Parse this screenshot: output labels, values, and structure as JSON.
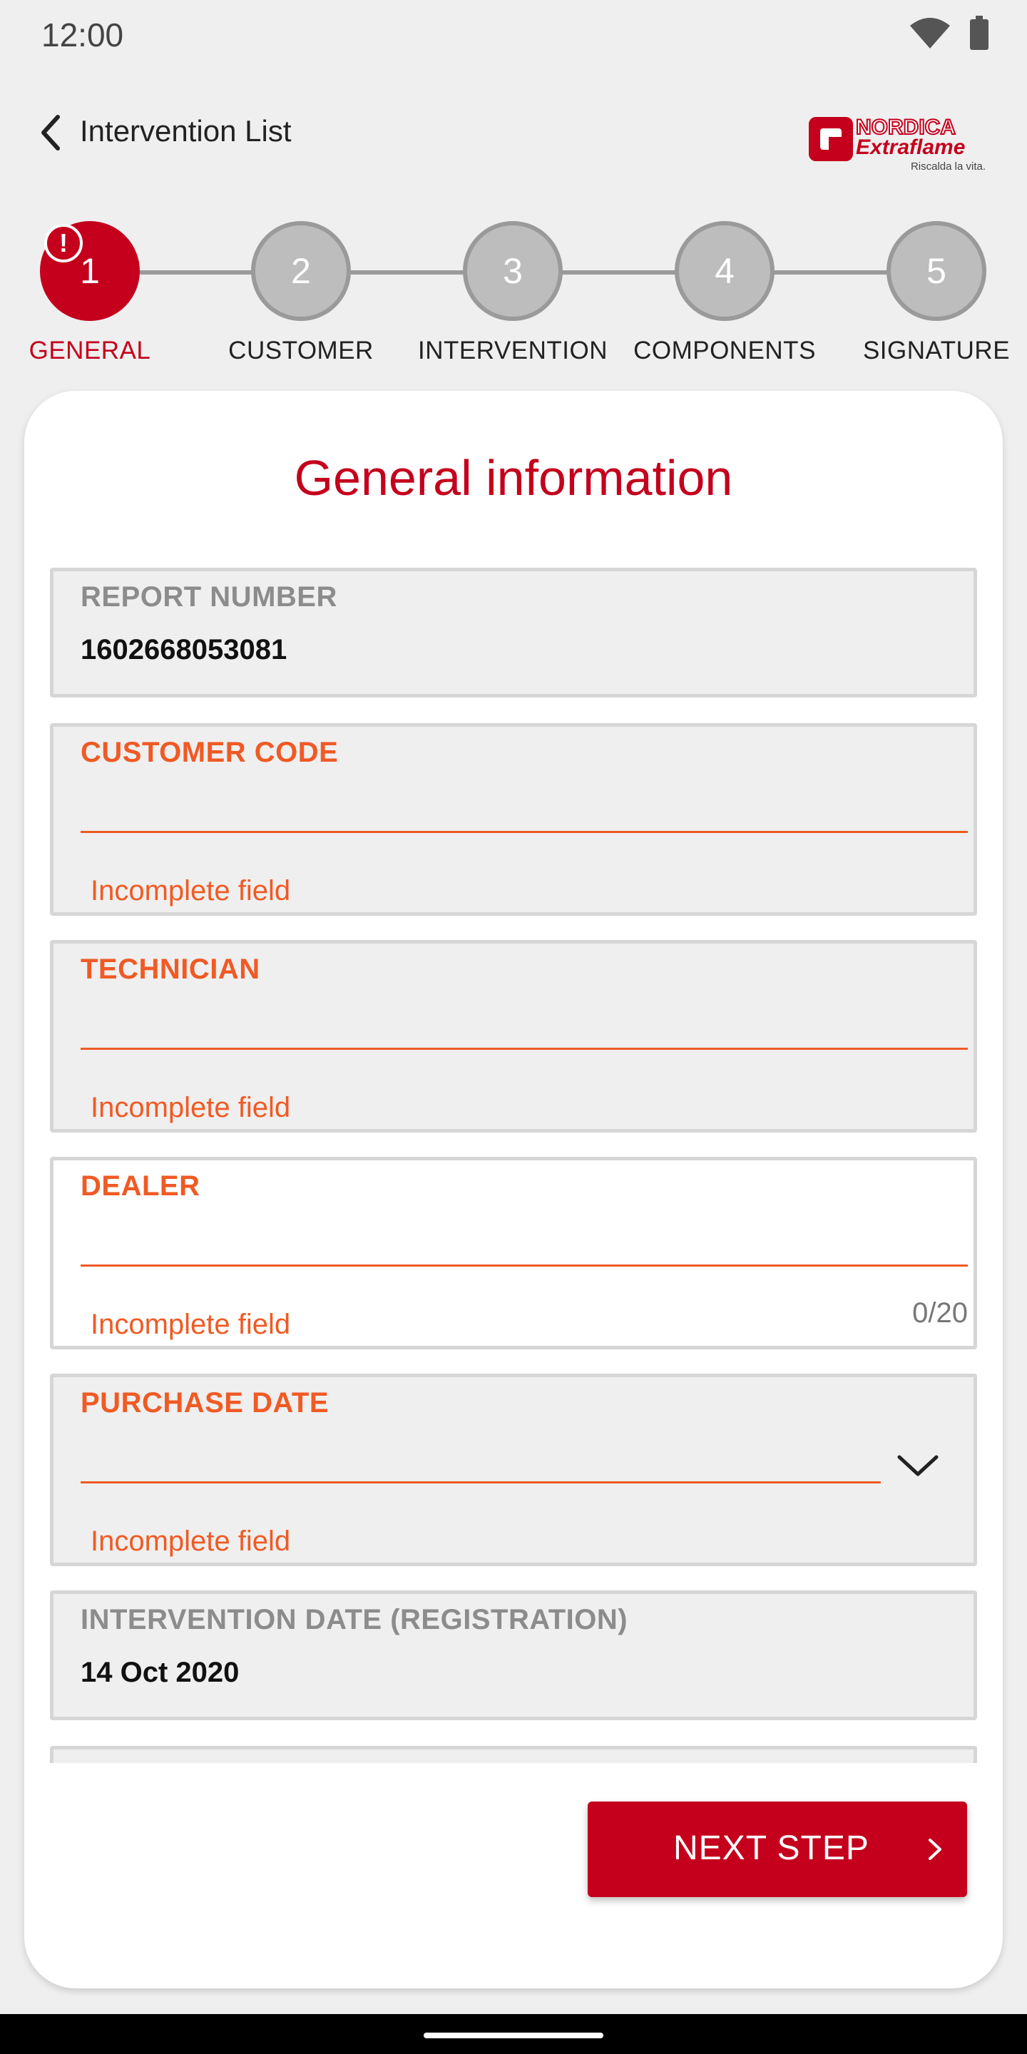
{
  "status_bar": {
    "time": "12:00",
    "icons": [
      "wifi-icon",
      "battery-icon"
    ]
  },
  "app_bar": {
    "back_label": "Intervention List"
  },
  "logo": {
    "brand_top": "NORDICA",
    "brand_bottom": "Extraflame",
    "tagline": "Riscalda la vita."
  },
  "stepper": {
    "steps": [
      {
        "number": "1",
        "label": "GENERAL",
        "active": true,
        "alert": "!"
      },
      {
        "number": "2",
        "label": "CUSTOMER"
      },
      {
        "number": "3",
        "label": "INTERVENTION"
      },
      {
        "number": "4",
        "label": "COMPONENTS"
      },
      {
        "number": "5",
        "label": "SIGNATURE"
      }
    ]
  },
  "form": {
    "title": "General information",
    "report_number": {
      "label": "REPORT NUMBER",
      "value": "1602668053081"
    },
    "customer_code": {
      "label": "CUSTOMER CODE",
      "value": "",
      "error": "Incomplete field"
    },
    "technician": {
      "label": "TECHNICIAN",
      "value": "",
      "error": "Incomplete field"
    },
    "dealer": {
      "label": "DEALER",
      "value": "",
      "error": "Incomplete field",
      "counter": "0/20"
    },
    "purchase_date": {
      "label": "PURCHASE DATE",
      "value": "",
      "error": "Incomplete field"
    },
    "intervention_date": {
      "label": "INTERVENTION DATE (REGISTRATION)",
      "value": "14 Oct 2020"
    },
    "next_button": "NEXT STEP"
  },
  "colors": {
    "primary_red": "#c4001c",
    "error_orange": "#f05a24",
    "background": "#efefef"
  }
}
